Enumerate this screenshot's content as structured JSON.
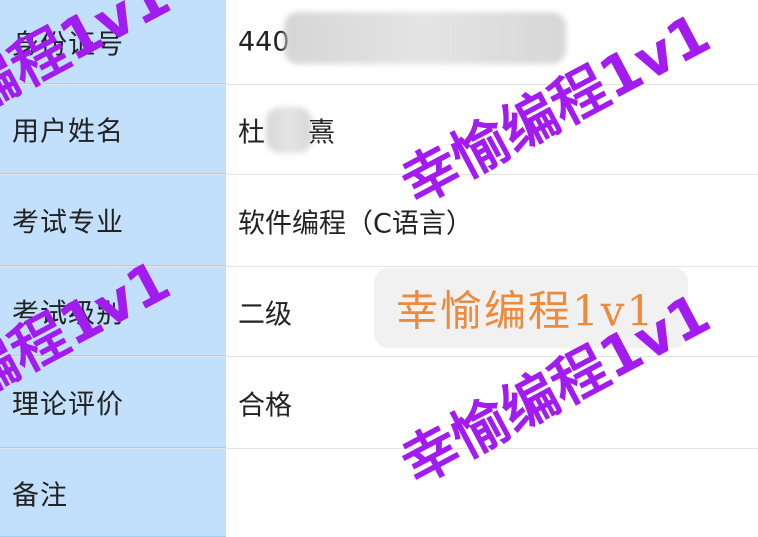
{
  "rows": [
    {
      "label": "身份证号",
      "value": "440"
    },
    {
      "label": "用户姓名",
      "value": "杜"
    },
    {
      "label": "考试专业",
      "value": "软件编程（C语言）"
    },
    {
      "label": "考试级别",
      "value": "二级"
    },
    {
      "label": "理论评价",
      "value": "合格"
    },
    {
      "label": "备注",
      "value": ""
    }
  ],
  "watermarks": [
    "幸愉编程1v1",
    "幸愉编程1v1",
    "幸愉编程1v1",
    "幸愉编程1v1"
  ],
  "stamp_text": "幸愉编程1v1",
  "name_tail": "熹",
  "colors": {
    "label_bg": "#c2e0fb",
    "watermark": "#a21cf0",
    "stamp_text": "#ec8a3e"
  }
}
